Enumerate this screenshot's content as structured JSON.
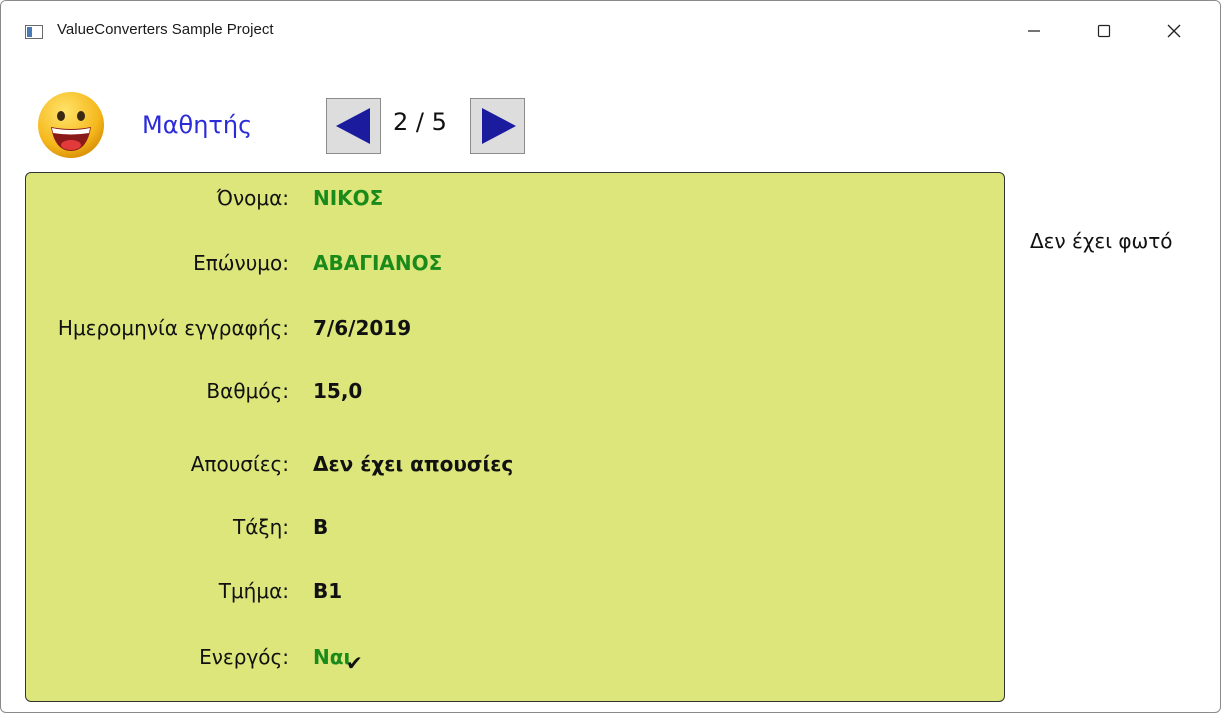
{
  "window": {
    "title": "ValueConverters Sample Project"
  },
  "header": {
    "section_title": "Μαθητής",
    "page_counter": "2 / 5"
  },
  "student": {
    "fields": [
      {
        "label": "Όνομα:",
        "value": "ΝΙΚΟΣ",
        "color": "#1a8a1a"
      },
      {
        "label": "Επώνυμο:",
        "value": "ΑΒΑΓΙΑΝΟΣ",
        "color": "#1a8a1a"
      },
      {
        "label": "Ημερομηνία εγγραφής:",
        "value": "7/6/2019",
        "color": "#111111"
      },
      {
        "label": "Βαθμός:",
        "value": "15,0",
        "color": "#111111"
      },
      {
        "label": "Απουσίες:",
        "value": "Δεν έχει απουσίες",
        "color": "#111111"
      },
      {
        "label": "Τάξη:",
        "value": "Β",
        "color": "#111111"
      },
      {
        "label": "Τμήμα:",
        "value": "Β1",
        "color": "#111111"
      },
      {
        "label": "Ενεργός:",
        "value": "Ναι",
        "color": "#1a8a1a",
        "mark": "✔"
      }
    ]
  },
  "photo": {
    "placeholder_text": "Δεν έχει φωτό"
  },
  "colors": {
    "card_bg": "#dce67a",
    "title_blue": "#2b2bdb",
    "arrow_blue": "#1b1b9e",
    "value_green": "#1a8a1a"
  }
}
